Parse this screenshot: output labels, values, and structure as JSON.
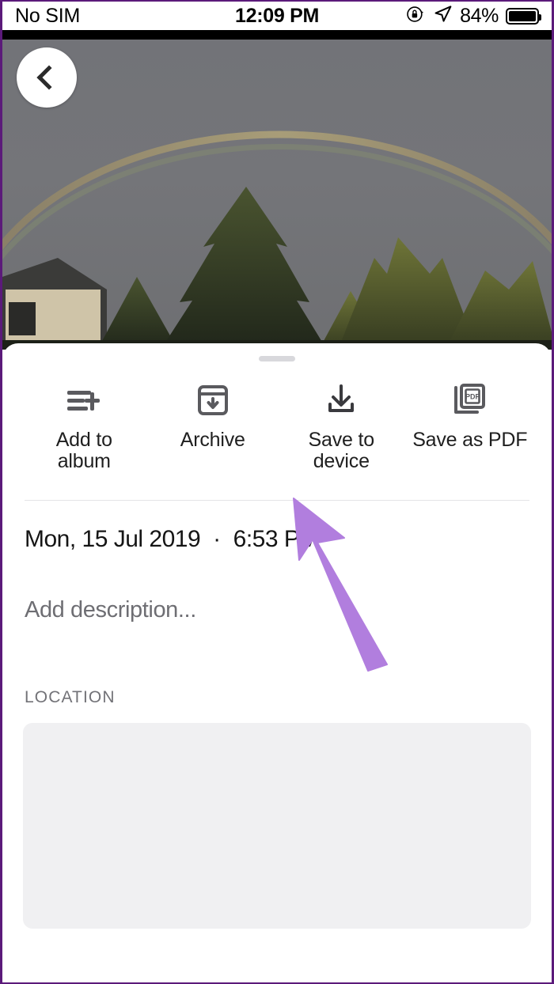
{
  "status_bar": {
    "carrier": "No SIM",
    "time": "12:09 PM",
    "battery_percent": "84%",
    "rotation_lock_icon": "rotation-lock-icon",
    "location_icon": "location-arrow-icon",
    "battery_icon": "battery-icon"
  },
  "photo": {
    "back_icon": "back-chevron-icon",
    "alt": "Rainbow over trees against a grey sky"
  },
  "sheet": {
    "drag_handle": "drag-handle",
    "actions": [
      {
        "label": "Add to\nalbum",
        "icon": "add-to-album-icon"
      },
      {
        "label": "Archive",
        "icon": "archive-icon"
      },
      {
        "label": "Save to\ndevice",
        "icon": "download-icon"
      },
      {
        "label": "Save as PDF",
        "icon": "pdf-icon"
      }
    ],
    "date": "Mon, 15 Jul 2019",
    "separator": "·",
    "time": "6:53 PM",
    "description_placeholder": "Add description...",
    "location_heading": "LOCATION"
  },
  "annotation": {
    "arrow_color": "#b17ede",
    "points_to": "Save to device"
  },
  "colors": {
    "accent_purple": "#b17ede",
    "frame_border": "#5b1a7a",
    "icon_gray": "#5a5a5e",
    "text_primary": "#1f1f1f",
    "text_secondary": "#6e6e73",
    "map_placeholder": "#f0f0f2"
  }
}
